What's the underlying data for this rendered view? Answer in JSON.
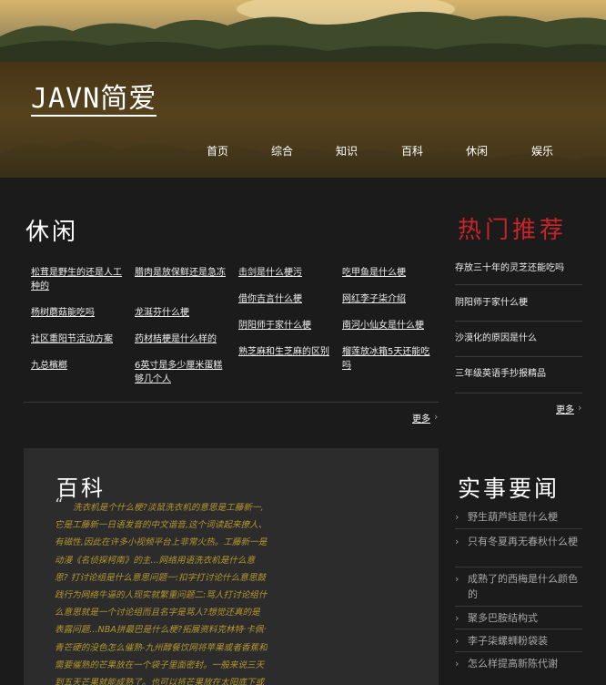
{
  "site": {
    "title": "JAVN简爱"
  },
  "nav": [
    "首页",
    "综合",
    "知识",
    "百科",
    "休闲",
    "娱乐"
  ],
  "leisure": {
    "title": "休闲",
    "columns": [
      [
        "松茸是野生的还是人工种的",
        "杨树蘑菇能吃吗",
        "社区重阳节活动方案",
        "九总檳榔"
      ],
      [
        "腊肉是放保鲜还是急冻",
        "龙涎芬什么梗",
        "药材桔梗是什么样的",
        "6英寸是多少厘米蛋糕够几个人"
      ],
      [
        "击剑是什么梗污",
        "借你吉言什么梗",
        "阴阳师于家什么梗",
        "熟芝麻和生芝麻的区别"
      ],
      [
        "吃甲鱼是什么梗",
        "网红李子柒介绍",
        "南河小仙女是什么梗",
        "榴莲放冰箱5天还能吃吗"
      ]
    ],
    "more": "更多"
  },
  "hot": {
    "title": "热门推荐",
    "items": [
      "存放三十年的灵芝还能吃吗",
      "阴阳师于家什么梗",
      "沙漠化的原因是什么",
      "三年级英语手抄报精品"
    ],
    "more": "更多"
  },
  "baike": {
    "title": "百科",
    "quote_mark": "“",
    "text": "洗衣机是个什么梗?淡鼠洗衣机的意思是工藤新一,它是工藤新一日语发音的中文谐音,这个词读起来撩人、有磁性,因此在许多小视频平台上非常火热。工藤新一是动漫《名侦探柯南》的主...网络用语洗衣机是什么意思? 打讨论组是什么意思问题一:扣字打讨论什么意思鼓践行为网络牛逼的人现实就繁重问题二:骂人打讨论组什么意思就是一个讨论组而且名字是骂人?想觉还真的是表露问题...NBA拼最巴是什么梗?拓展资料克林特·卡佩·青芒硬的没色怎么催熟-九州醇餐饮网将苹果或者香蕉和需要催熟的芒果放在一个袋子里面密封。一般来说三天到五天芒果就能成熟了。也可以将芒果放在太阳底下或者是别"
  },
  "news": {
    "title": "实事要闻",
    "items": [
      "野生葫芦娃是什么梗",
      "只有冬夏再无春秋什么梗",
      "成熟了的西梅是什么颜色的",
      "聚多巴胺结构式",
      "李子柒螺蛳粉袋装",
      "怎么样提高新陈代谢"
    ]
  }
}
